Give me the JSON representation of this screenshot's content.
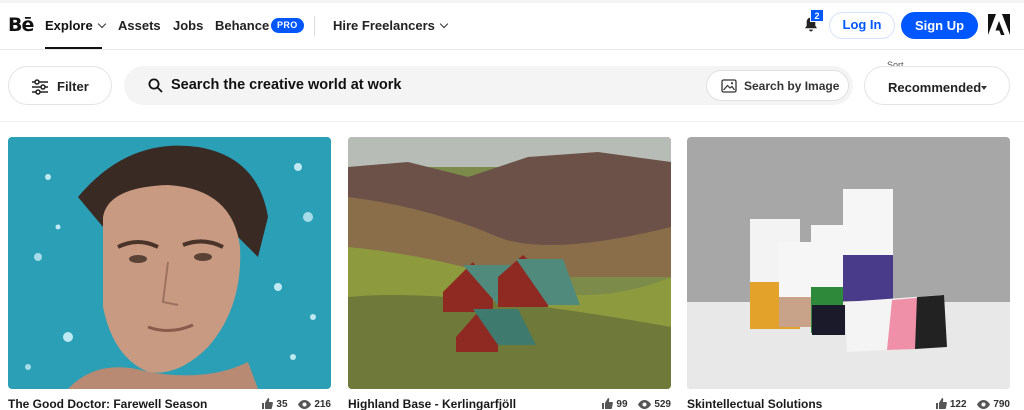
{
  "nav": {
    "logo": "Bē",
    "items": [
      {
        "label": "Explore",
        "has_chevron": true,
        "active": true
      },
      {
        "label": "Assets"
      },
      {
        "label": "Jobs"
      },
      {
        "label": "Behance"
      },
      {
        "label": "Hire Freelancers",
        "has_chevron": true
      }
    ],
    "pro_badge": "PRO",
    "notification_count": "2",
    "login_label": "Log In",
    "signup_label": "Sign Up",
    "icons": [
      "bell-icon",
      "adobe-logo"
    ]
  },
  "toolbar": {
    "filter_label": "Filter",
    "search_placeholder": "Search the creative world at work",
    "image_search_label": "Search by Image",
    "sort_caption": "Sort",
    "sort_value": "Recommended"
  },
  "projects": [
    {
      "title": "The Good Doctor: Farewell Season",
      "likes": "35",
      "views": "216"
    },
    {
      "title": "Highland Base - Kerlingarfjöll",
      "likes": "99",
      "views": "529"
    },
    {
      "title": "Skintellectual Solutions",
      "likes": "122",
      "views": "790"
    }
  ],
  "colors": {
    "accent": "#0057ff",
    "text": "#191919"
  }
}
